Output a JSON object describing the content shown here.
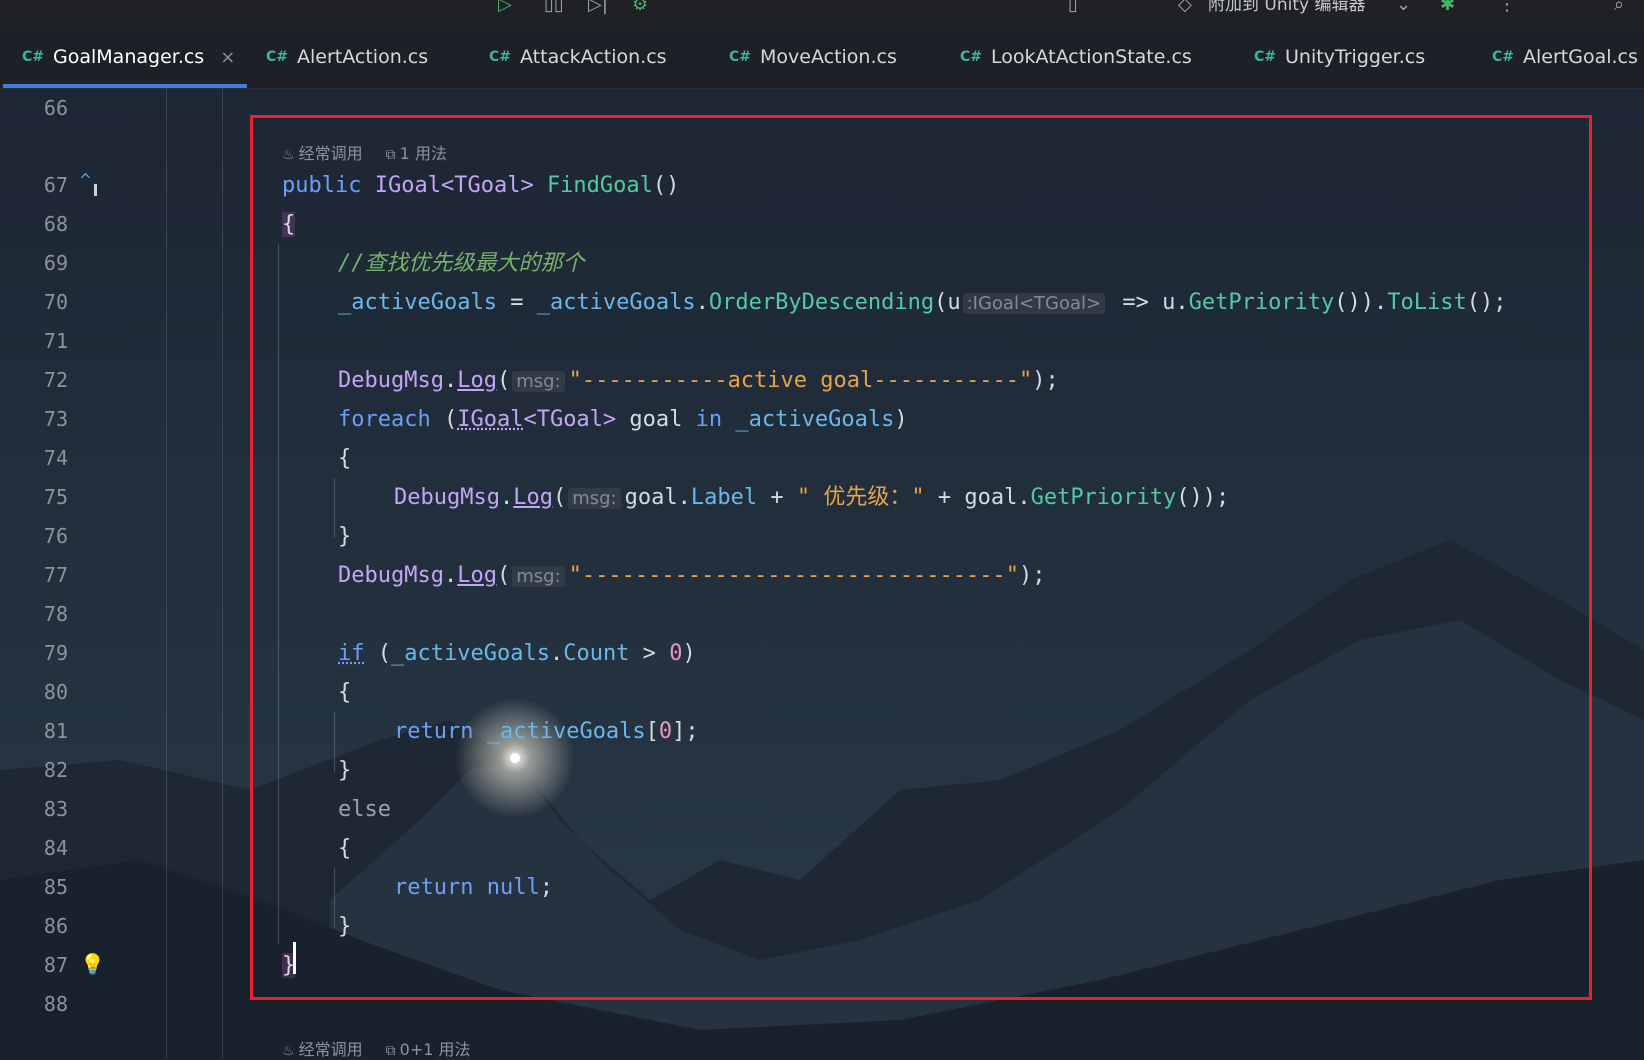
{
  "toolbar": {
    "attach_label": "附加到 Unity 编辑器"
  },
  "tabs": [
    {
      "lang": "C#",
      "label": "GoalManager.cs",
      "active": true
    },
    {
      "lang": "C#",
      "label": "AlertAction.cs"
    },
    {
      "lang": "C#",
      "label": "AttackAction.cs"
    },
    {
      "lang": "C#",
      "label": "MoveAction.cs"
    },
    {
      "lang": "C#",
      "label": "LookAtActionState.cs"
    },
    {
      "lang": "C#",
      "label": "UnityTrigger.cs"
    },
    {
      "lang": "C#",
      "label": "AlertGoal.cs"
    }
  ],
  "line_numbers": [
    "66",
    "67",
    "68",
    "69",
    "70",
    "71",
    "72",
    "73",
    "74",
    "75",
    "76",
    "77",
    "78",
    "79",
    "80",
    "81",
    "82",
    "83",
    "84",
    "85",
    "86",
    "87",
    "88"
  ],
  "code_lens": {
    "top_usage_freq": "经常调用",
    "top_usages": "1 用法",
    "bottom_usage_freq": "经常调用",
    "bottom_usages": "0+1 用法"
  },
  "code": {
    "l67": {
      "kw": "public",
      "ret_type": "IGoal",
      "generic": "<TGoal>",
      "method": "FindGoal",
      "parens": "()"
    },
    "l68": "{",
    "l69": "//查找优先级最大的那个",
    "l70": {
      "lhs": "_activeGoals",
      "eq": " = ",
      "rhs": "_activeGoals",
      "dot": ".",
      "call": "OrderByDescending",
      "open": "(",
      "param": "u",
      "hint": ":IGoal<TGoal>",
      "arrow": " => ",
      "u2": "u",
      "dot2": ".",
      "call2": "GetPriority",
      "mid": "()).",
      "call3": "ToList",
      "end": "();"
    },
    "l72": {
      "cls": "DebugMsg",
      "dot": ".",
      "fn": "Log",
      "open": "(",
      "hint": "msg:",
      "str": "\"-----------active goal-----------\"",
      "end": ");"
    },
    "l73": {
      "kw": "foreach",
      "open": " (",
      "type": "IGoal",
      "generic": "<TGoal>",
      "var": " goal ",
      "in": "in",
      "coll": " _activeGoals",
      "close": ")"
    },
    "l74": "{",
    "l75": {
      "cls": "DebugMsg",
      "dot": ".",
      "fn": "Log",
      "open": "(",
      "hint": "msg:",
      "goal": "goal",
      "dot2": ".",
      "label": "Label",
      "plus": " + ",
      "str": "\" 优先级：\"",
      "plus2": " + ",
      "goal2": "goal",
      "dot3": ".",
      "call": "GetPriority",
      "end": "());"
    },
    "l76": "}",
    "l77": {
      "cls": "DebugMsg",
      "dot": ".",
      "fn": "Log",
      "open": "(",
      "hint": "msg:",
      "str": "\"--------------------------------\"",
      "end": ");"
    },
    "l79": {
      "kw": "if",
      "open": " (",
      "coll": "_activeGoals",
      "dot": ".",
      "prop": "Count",
      "op": " > ",
      "num": "0",
      "close": ")"
    },
    "l80": "{",
    "l81": {
      "kw": "return",
      "coll": " _activeGoals",
      "br": "[",
      "num": "0",
      "end": "];"
    },
    "l82": "}",
    "l83": "else",
    "l84": "{",
    "l85": {
      "kw": "return",
      "null": " null",
      "end": ";"
    },
    "l86": "}",
    "l87": "}"
  },
  "colors": {
    "keyword": "#6d9ff6",
    "type": "#c4a4f7",
    "method": "#56c8a4",
    "string": "#e8a24a",
    "comment": "#77b26a",
    "number": "#ed94c0",
    "highlight_box": "#e8232f",
    "tab_underline": "#3f7ee0"
  }
}
